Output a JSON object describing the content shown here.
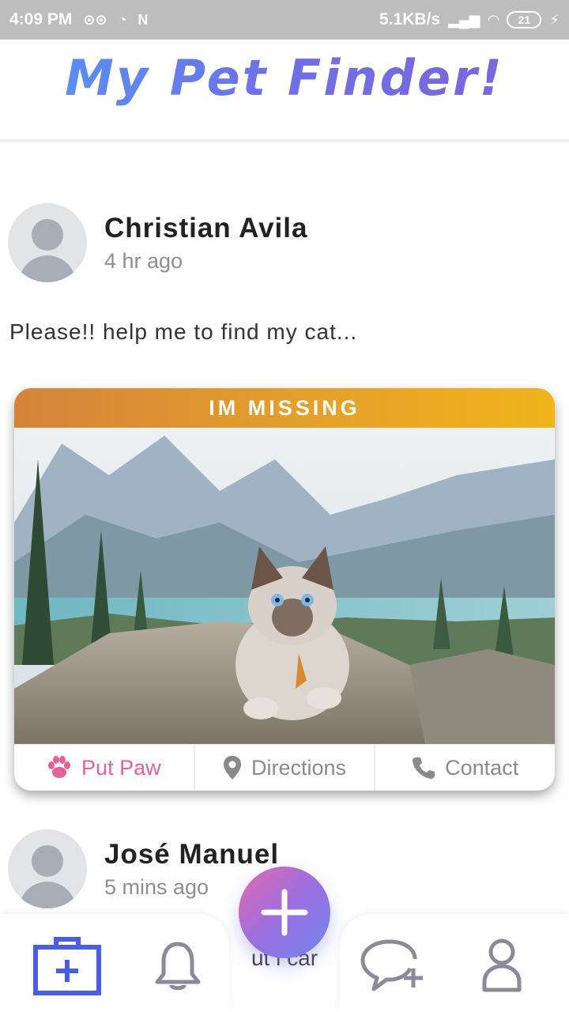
{
  "status_bar": {
    "time": "4:09 PM",
    "net_speed": "5.1KB/s",
    "battery": "21"
  },
  "header": {
    "title": "My Pet Finder!"
  },
  "posts": [
    {
      "author": "Christian Avila",
      "time": "4 hr ago",
      "text": "Please!! help me to find my cat...",
      "card": {
        "banner": "IM MISSING",
        "actions": [
          {
            "label": "Put Paw",
            "icon": "paw-icon"
          },
          {
            "label": "Directions",
            "icon": "location-pin-icon"
          },
          {
            "label": "Contact",
            "icon": "phone-icon"
          }
        ]
      }
    },
    {
      "author": "José Manuel",
      "time": "5 mins ago",
      "text_partial": "ut i car"
    }
  ],
  "bottom_nav": {
    "items": [
      {
        "icon": "first-aid-kit-icon",
        "active": true
      },
      {
        "icon": "bell-icon",
        "active": false
      },
      {
        "icon": "add-chat-icon",
        "active": false
      },
      {
        "icon": "user-icon",
        "active": false
      }
    ],
    "fab_icon": "plus-icon"
  },
  "colors": {
    "accent_blue": "#4a5fe0",
    "paw_pink": "#e4629a",
    "banner_start": "#d4843a",
    "banner_end": "#f0b41c",
    "inactive_icon": "#8a8a9a"
  }
}
